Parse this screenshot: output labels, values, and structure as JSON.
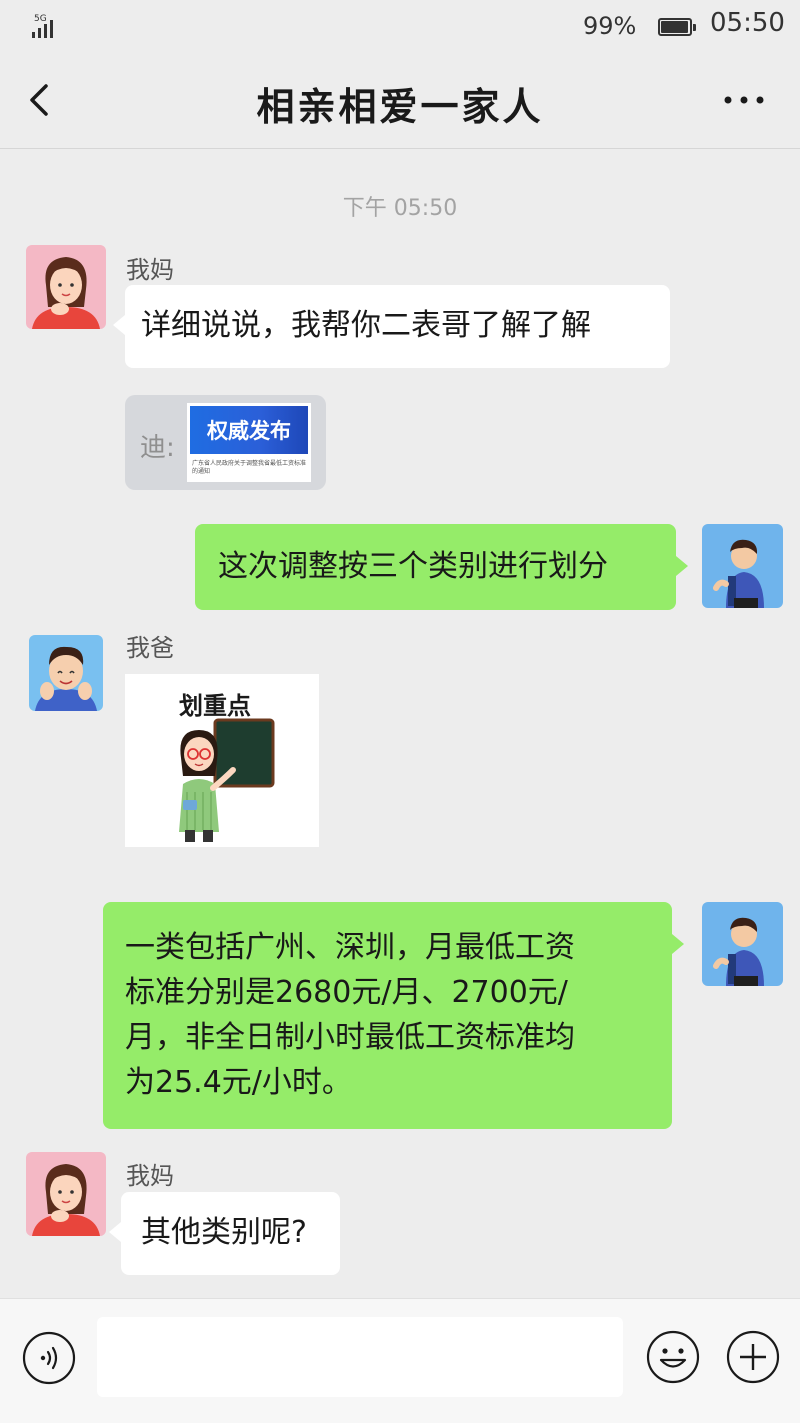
{
  "status_bar": {
    "network": "5G",
    "battery": "99%",
    "time": "05:50"
  },
  "header": {
    "back_icon": "chevron-left-icon",
    "title": "相亲相爱一家人",
    "more_icon": "ellipsis-icon"
  },
  "chat": {
    "timestamp": "下午 05:50",
    "messages": [
      {
        "sender": "我妈",
        "text": "详细说说，我帮你二表哥了解了解"
      },
      {
        "prefix": "迪:",
        "card_title": "权威发布",
        "card_caption": "广东省人民政府关于调整我省最低工资标准的通知"
      },
      {
        "sender": "me",
        "text": "这次调整按三个类别进行划分"
      },
      {
        "sender": "我爸",
        "sticker_text": "划重点"
      },
      {
        "sender": "me",
        "lines": [
          "一类包括广州、深圳，月最低工资",
          "标准分别是2680元/月、2700元/",
          "月，非全日制小时最低工资标准均",
          "为25.4元/小时。"
        ]
      },
      {
        "sender": "我妈",
        "text": "其他类别呢?"
      }
    ]
  },
  "input_bar": {
    "voice_icon": "voice-icon",
    "input_placeholder": "",
    "emoji_icon": "smiley-icon",
    "plus_icon": "plus-icon"
  },
  "colors": {
    "background": "#ededed",
    "sent_bubble": "#95ec69",
    "received_bubble": "#ffffff"
  }
}
